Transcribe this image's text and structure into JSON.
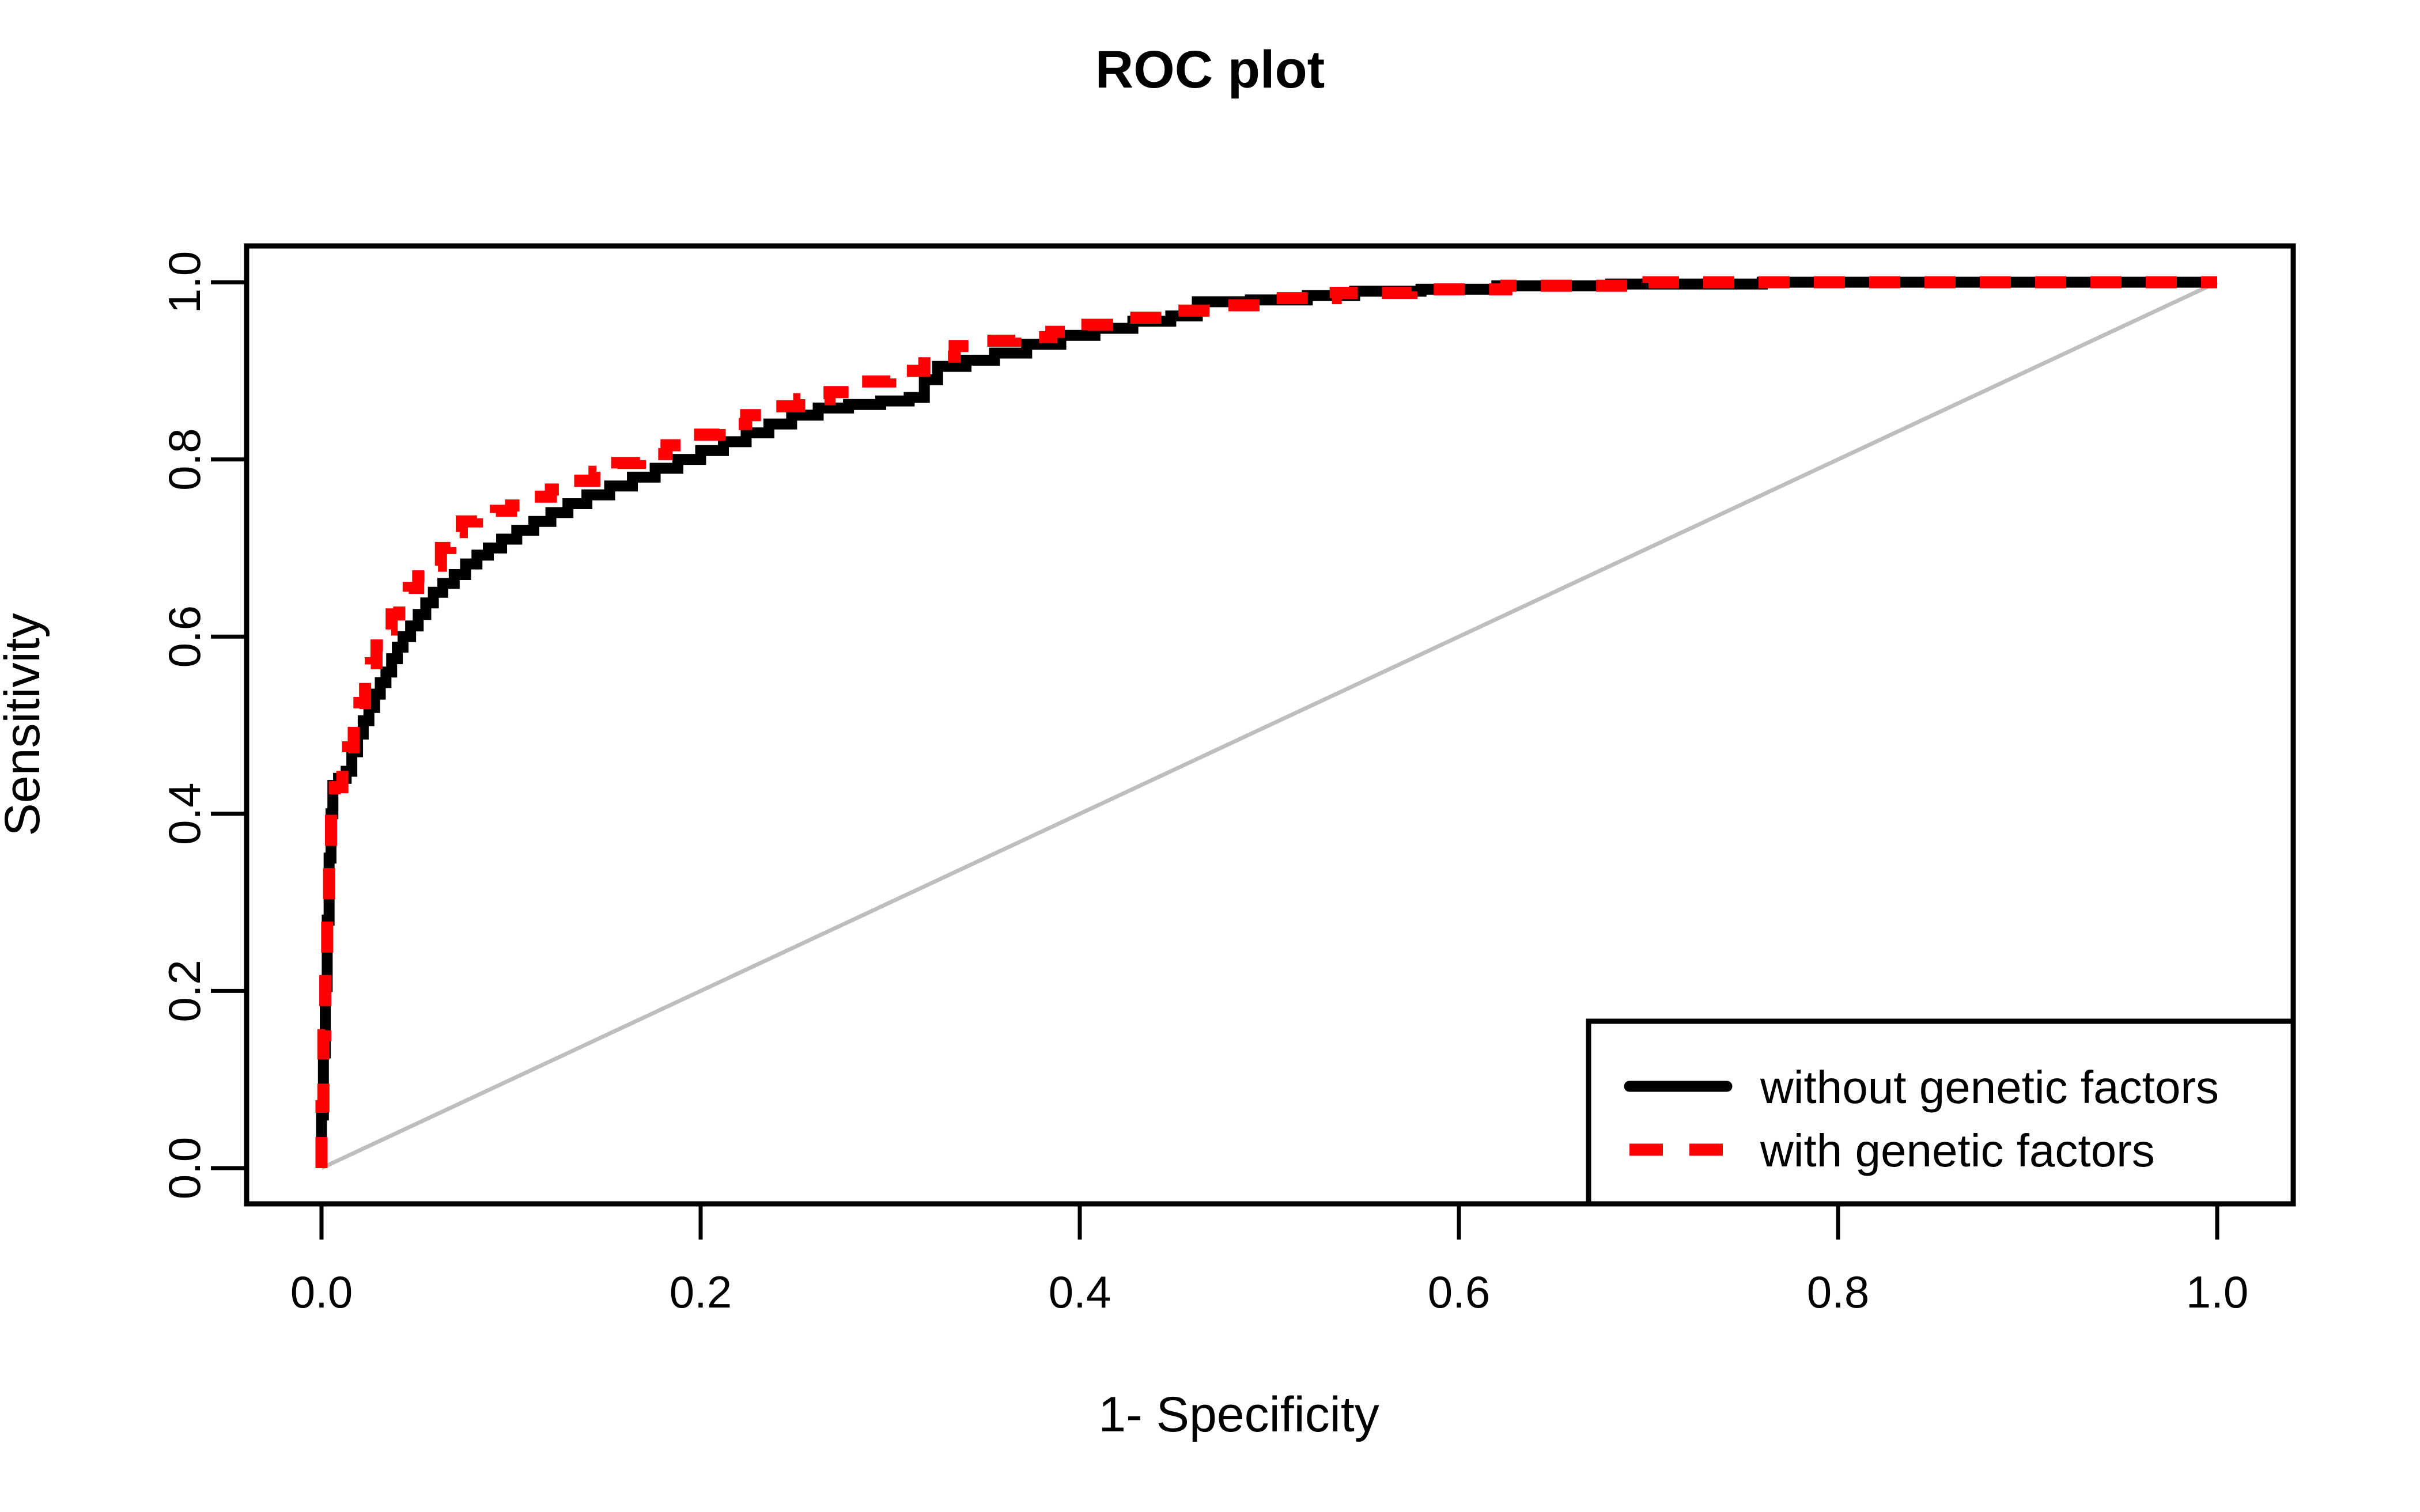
{
  "chart_data": {
    "type": "line",
    "title": "ROC plot",
    "xlabel": "1- Specificity",
    "ylabel": "Sensitivity",
    "xlim": [
      0,
      1
    ],
    "ylim": [
      0,
      1
    ],
    "xticks": [
      "0.0",
      "0.2",
      "0.4",
      "0.6",
      "0.8",
      "1.0"
    ],
    "xtick_values": [
      0.0,
      0.2,
      0.4,
      0.6,
      0.8,
      1.0
    ],
    "yticks": [
      "0.0",
      "0.2",
      "0.4",
      "0.6",
      "0.8",
      "1.0"
    ],
    "ytick_values": [
      0.0,
      0.2,
      0.4,
      0.6,
      0.8,
      1.0
    ],
    "grid": false,
    "legend_position": "bottom-right",
    "reference_line": {
      "name": "chance-diagonal",
      "from": [
        0.0,
        0.0
      ],
      "to": [
        1.0,
        1.0
      ],
      "color": "#BEBEBE",
      "style": "solid"
    },
    "series": [
      {
        "name": "without genetic factors",
        "color": "#000000",
        "style": "solid",
        "points": [
          [
            0.0,
            0.0
          ],
          [
            0.0,
            0.06
          ],
          [
            0.001,
            0.06
          ],
          [
            0.001,
            0.13
          ],
          [
            0.002,
            0.13
          ],
          [
            0.002,
            0.205
          ],
          [
            0.003,
            0.205
          ],
          [
            0.003,
            0.28
          ],
          [
            0.004,
            0.28
          ],
          [
            0.004,
            0.35
          ],
          [
            0.005,
            0.35
          ],
          [
            0.005,
            0.4
          ],
          [
            0.006,
            0.4
          ],
          [
            0.006,
            0.432
          ],
          [
            0.009,
            0.432
          ],
          [
            0.009,
            0.44
          ],
          [
            0.013,
            0.44
          ],
          [
            0.013,
            0.448
          ],
          [
            0.016,
            0.448
          ],
          [
            0.016,
            0.47
          ],
          [
            0.019,
            0.47
          ],
          [
            0.019,
            0.49
          ],
          [
            0.022,
            0.49
          ],
          [
            0.022,
            0.505
          ],
          [
            0.025,
            0.505
          ],
          [
            0.025,
            0.52
          ],
          [
            0.028,
            0.52
          ],
          [
            0.028,
            0.535
          ],
          [
            0.031,
            0.535
          ],
          [
            0.031,
            0.548
          ],
          [
            0.034,
            0.548
          ],
          [
            0.034,
            0.56
          ],
          [
            0.037,
            0.56
          ],
          [
            0.037,
            0.575
          ],
          [
            0.04,
            0.575
          ],
          [
            0.04,
            0.588
          ],
          [
            0.043,
            0.588
          ],
          [
            0.043,
            0.6
          ],
          [
            0.047,
            0.6
          ],
          [
            0.047,
            0.612
          ],
          [
            0.051,
            0.612
          ],
          [
            0.051,
            0.625
          ],
          [
            0.055,
            0.625
          ],
          [
            0.055,
            0.638
          ],
          [
            0.059,
            0.638
          ],
          [
            0.059,
            0.65
          ],
          [
            0.064,
            0.65
          ],
          [
            0.064,
            0.66
          ],
          [
            0.07,
            0.66
          ],
          [
            0.07,
            0.67
          ],
          [
            0.076,
            0.67
          ],
          [
            0.076,
            0.682
          ],
          [
            0.082,
            0.682
          ],
          [
            0.082,
            0.692
          ],
          [
            0.088,
            0.692
          ],
          [
            0.088,
            0.7
          ],
          [
            0.095,
            0.7
          ],
          [
            0.095,
            0.71
          ],
          [
            0.103,
            0.71
          ],
          [
            0.103,
            0.72
          ],
          [
            0.112,
            0.72
          ],
          [
            0.112,
            0.73
          ],
          [
            0.121,
            0.73
          ],
          [
            0.121,
            0.74
          ],
          [
            0.13,
            0.74
          ],
          [
            0.13,
            0.75
          ],
          [
            0.14,
            0.75
          ],
          [
            0.14,
            0.76
          ],
          [
            0.152,
            0.76
          ],
          [
            0.152,
            0.77
          ],
          [
            0.164,
            0.77
          ],
          [
            0.164,
            0.78
          ],
          [
            0.176,
            0.78
          ],
          [
            0.176,
            0.79
          ],
          [
            0.188,
            0.79
          ],
          [
            0.188,
            0.8
          ],
          [
            0.2,
            0.8
          ],
          [
            0.2,
            0.81
          ],
          [
            0.212,
            0.81
          ],
          [
            0.212,
            0.82
          ],
          [
            0.224,
            0.82
          ],
          [
            0.224,
            0.83
          ],
          [
            0.236,
            0.83
          ],
          [
            0.236,
            0.84
          ],
          [
            0.248,
            0.84
          ],
          [
            0.248,
            0.85
          ],
          [
            0.262,
            0.85
          ],
          [
            0.262,
            0.858
          ],
          [
            0.278,
            0.858
          ],
          [
            0.278,
            0.862
          ],
          [
            0.295,
            0.862
          ],
          [
            0.295,
            0.866
          ],
          [
            0.31,
            0.866
          ],
          [
            0.31,
            0.87
          ],
          [
            0.318,
            0.87
          ],
          [
            0.318,
            0.89
          ],
          [
            0.325,
            0.89
          ],
          [
            0.325,
            0.905
          ],
          [
            0.34,
            0.905
          ],
          [
            0.34,
            0.912
          ],
          [
            0.355,
            0.912
          ],
          [
            0.355,
            0.92
          ],
          [
            0.372,
            0.92
          ],
          [
            0.372,
            0.93
          ],
          [
            0.39,
            0.93
          ],
          [
            0.39,
            0.94
          ],
          [
            0.408,
            0.94
          ],
          [
            0.408,
            0.948
          ],
          [
            0.428,
            0.948
          ],
          [
            0.428,
            0.956
          ],
          [
            0.448,
            0.956
          ],
          [
            0.448,
            0.962
          ],
          [
            0.462,
            0.962
          ],
          [
            0.462,
            0.978
          ],
          [
            0.49,
            0.978
          ],
          [
            0.49,
            0.98
          ],
          [
            0.52,
            0.98
          ],
          [
            0.52,
            0.985
          ],
          [
            0.545,
            0.985
          ],
          [
            0.545,
            0.99
          ],
          [
            0.58,
            0.99
          ],
          [
            0.58,
            0.992
          ],
          [
            0.62,
            0.992
          ],
          [
            0.62,
            0.996
          ],
          [
            0.68,
            0.996
          ],
          [
            0.68,
            0.998
          ],
          [
            0.76,
            0.998
          ],
          [
            0.76,
            1.0
          ],
          [
            1.0,
            1.0
          ]
        ]
      },
      {
        "name": "with genetic factors",
        "color": "#FF0000",
        "style": "dashed",
        "points": [
          [
            0.0,
            0.0
          ],
          [
            0.0,
            0.07
          ],
          [
            0.001,
            0.07
          ],
          [
            0.001,
            0.15
          ],
          [
            0.002,
            0.15
          ],
          [
            0.002,
            0.23
          ],
          [
            0.003,
            0.23
          ],
          [
            0.003,
            0.3
          ],
          [
            0.004,
            0.3
          ],
          [
            0.004,
            0.36
          ],
          [
            0.005,
            0.36
          ],
          [
            0.005,
            0.41
          ],
          [
            0.007,
            0.41
          ],
          [
            0.007,
            0.43
          ],
          [
            0.011,
            0.43
          ],
          [
            0.011,
            0.45
          ],
          [
            0.014,
            0.45
          ],
          [
            0.014,
            0.475
          ],
          [
            0.017,
            0.475
          ],
          [
            0.017,
            0.5
          ],
          [
            0.02,
            0.5
          ],
          [
            0.02,
            0.525
          ],
          [
            0.023,
            0.525
          ],
          [
            0.023,
            0.548
          ],
          [
            0.026,
            0.548
          ],
          [
            0.026,
            0.57
          ],
          [
            0.029,
            0.57
          ],
          [
            0.029,
            0.59
          ],
          [
            0.033,
            0.59
          ],
          [
            0.033,
            0.608
          ],
          [
            0.037,
            0.608
          ],
          [
            0.037,
            0.625
          ],
          [
            0.041,
            0.625
          ],
          [
            0.041,
            0.64
          ],
          [
            0.046,
            0.64
          ],
          [
            0.046,
            0.655
          ],
          [
            0.051,
            0.655
          ],
          [
            0.051,
            0.668
          ],
          [
            0.057,
            0.668
          ],
          [
            0.057,
            0.68
          ],
          [
            0.063,
            0.68
          ],
          [
            0.063,
            0.7
          ],
          [
            0.068,
            0.7
          ],
          [
            0.068,
            0.718
          ],
          [
            0.074,
            0.718
          ],
          [
            0.074,
            0.73
          ],
          [
            0.082,
            0.73
          ],
          [
            0.082,
            0.738
          ],
          [
            0.092,
            0.738
          ],
          [
            0.092,
            0.742
          ],
          [
            0.1,
            0.742
          ],
          [
            0.1,
            0.748
          ],
          [
            0.11,
            0.748
          ],
          [
            0.11,
            0.758
          ],
          [
            0.121,
            0.758
          ],
          [
            0.121,
            0.766
          ],
          [
            0.132,
            0.766
          ],
          [
            0.132,
            0.776
          ],
          [
            0.144,
            0.776
          ],
          [
            0.144,
            0.786
          ],
          [
            0.156,
            0.786
          ],
          [
            0.156,
            0.796
          ],
          [
            0.168,
            0.796
          ],
          [
            0.168,
            0.806
          ],
          [
            0.182,
            0.806
          ],
          [
            0.182,
            0.816
          ],
          [
            0.196,
            0.816
          ],
          [
            0.196,
            0.828
          ],
          [
            0.21,
            0.828
          ],
          [
            0.21,
            0.84
          ],
          [
            0.224,
            0.84
          ],
          [
            0.224,
            0.85
          ],
          [
            0.238,
            0.85
          ],
          [
            0.238,
            0.86
          ],
          [
            0.252,
            0.86
          ],
          [
            0.252,
            0.868
          ],
          [
            0.268,
            0.868
          ],
          [
            0.268,
            0.876
          ],
          [
            0.284,
            0.876
          ],
          [
            0.284,
            0.888
          ],
          [
            0.3,
            0.888
          ],
          [
            0.3,
            0.9
          ],
          [
            0.318,
            0.9
          ],
          [
            0.318,
            0.916
          ],
          [
            0.334,
            0.916
          ],
          [
            0.334,
            0.928
          ],
          [
            0.348,
            0.928
          ],
          [
            0.348,
            0.934
          ],
          [
            0.366,
            0.934
          ],
          [
            0.366,
            0.938
          ],
          [
            0.385,
            0.938
          ],
          [
            0.385,
            0.944
          ],
          [
            0.404,
            0.944
          ],
          [
            0.404,
            0.952
          ],
          [
            0.424,
            0.952
          ],
          [
            0.424,
            0.96
          ],
          [
            0.446,
            0.96
          ],
          [
            0.446,
            0.968
          ],
          [
            0.47,
            0.968
          ],
          [
            0.47,
            0.974
          ],
          [
            0.5,
            0.974
          ],
          [
            0.5,
            0.982
          ],
          [
            0.535,
            0.982
          ],
          [
            0.535,
            0.988
          ],
          [
            0.575,
            0.988
          ],
          [
            0.575,
            0.992
          ],
          [
            0.625,
            0.992
          ],
          [
            0.625,
            0.996
          ],
          [
            0.7,
            0.996
          ],
          [
            0.7,
            1.0
          ],
          [
            1.0,
            1.0
          ]
        ]
      }
    ]
  },
  "legend": {
    "items": [
      {
        "label": "without genetic factors",
        "color": "#000000",
        "style": "solid"
      },
      {
        "label": "with genetic factors",
        "color": "#FF0000",
        "style": "dashed"
      }
    ]
  }
}
